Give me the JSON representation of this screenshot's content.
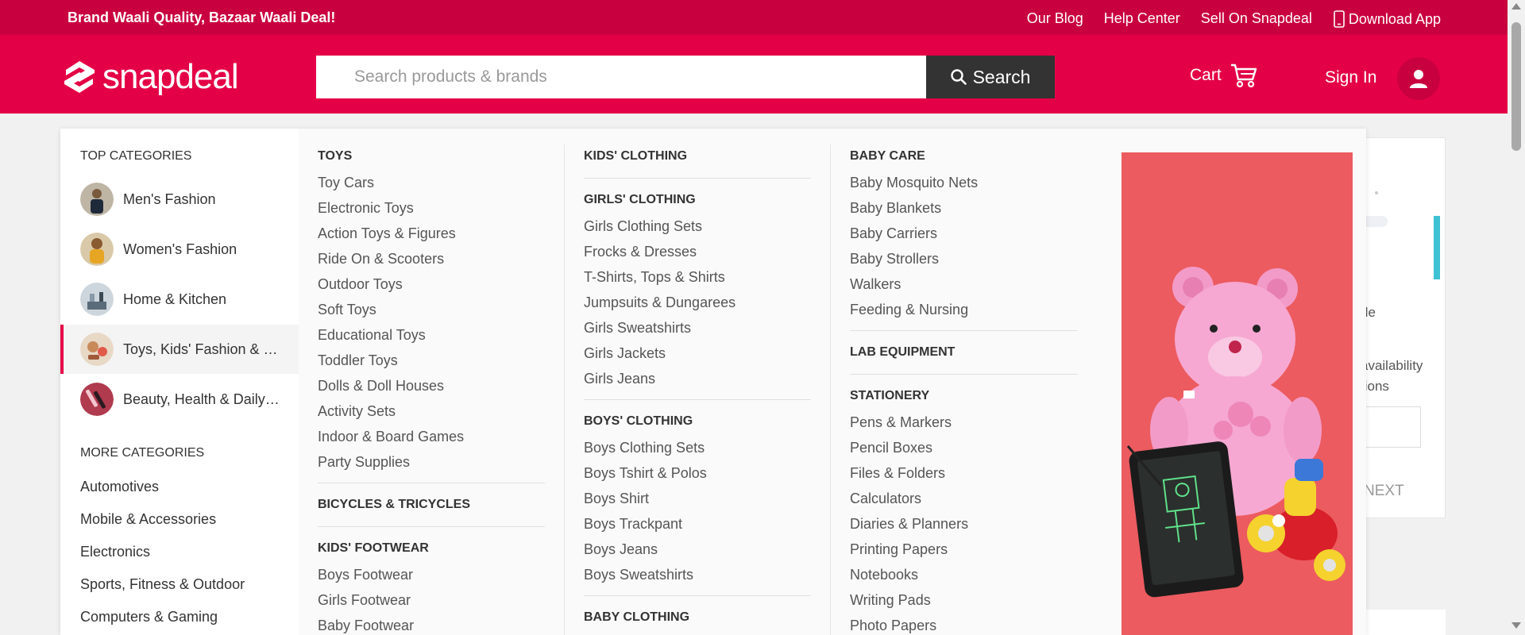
{
  "topbar": {
    "tagline": "Brand Waali Quality, Bazaar Waali Deal!",
    "links": {
      "blog": "Our Blog",
      "help": "Help Center",
      "sell": "Sell On Snapdeal",
      "download": "Download App"
    }
  },
  "header": {
    "logo_text": "snapdeal",
    "search": {
      "placeholder": "Search products & brands",
      "button_label": "Search"
    },
    "cart_label": "Cart",
    "signin_label": "Sign In"
  },
  "colors": {
    "topbar": "#c9003f",
    "header": "#e40046",
    "search_button": "#333333",
    "promo_bg": "#ec5b5f"
  },
  "leftnav": {
    "top_heading": "TOP CATEGORIES",
    "top_categories": [
      {
        "label": "Men's Fashion"
      },
      {
        "label": "Women's Fashion"
      },
      {
        "label": "Home & Kitchen"
      },
      {
        "label": "Toys, Kids' Fashion & more"
      },
      {
        "label": "Beauty, Health & Daily Needs"
      }
    ],
    "more_heading": "MORE CATEGORIES",
    "more_categories": [
      "Automotives",
      "Mobile & Accessories",
      "Electronics",
      "Sports, Fitness & Outdoor",
      "Computers & Gaming"
    ]
  },
  "menu": {
    "col1": {
      "toys_heading": "TOYS",
      "toys": [
        "Toy Cars",
        "Electronic Toys",
        "Action Toys & Figures",
        "Ride On & Scooters",
        "Outdoor Toys",
        "Soft Toys",
        "Educational Toys",
        "Toddler Toys",
        "Dolls & Doll Houses",
        "Activity Sets",
        "Indoor & Board Games",
        "Party Supplies"
      ],
      "bicycles_heading": "BICYCLES & TRICYCLES",
      "footwear_heading": "KIDS' FOOTWEAR",
      "footwear": [
        "Boys Footwear",
        "Girls Footwear",
        "Baby Footwear"
      ]
    },
    "col2": {
      "kids_heading": "KIDS' CLOTHING",
      "girls_heading": "GIRLS' CLOTHING",
      "girls": [
        "Girls Clothing Sets",
        "Frocks & Dresses",
        "T-Shirts, Tops & Shirts",
        "Jumpsuits & Dungarees",
        "Girls Sweatshirts",
        "Girls Jackets",
        "Girls Jeans"
      ],
      "boys_heading": "BOYS' CLOTHING",
      "boys": [
        "Boys Clothing Sets",
        "Boys Tshirt & Polos",
        "Boys Shirt",
        "Boys Trackpant",
        "Boys Jeans",
        "Boys Sweatshirts"
      ],
      "baby_heading": "BABY CLOTHING"
    },
    "col3": {
      "babycare_heading": "BABY CARE",
      "babycare": [
        "Baby Mosquito Nets",
        "Baby Blankets",
        "Baby Carriers",
        "Baby Strollers",
        "Walkers",
        "Feeding & Nursing"
      ],
      "lab_heading": "LAB EQUIPMENT",
      "stationery_heading": "STATIONERY",
      "stationery": [
        "Pens & Markers",
        "Pencil Boxes",
        "Files & Folders",
        "Calculators",
        "Diaries & Planners",
        "Printing Papers",
        "Notebooks",
        "Writing Pads",
        "Photo Papers"
      ]
    }
  },
  "background_card": {
    "frag1": "de",
    "frag2_line1": "availability",
    "frag2_line2": "tions",
    "next_label": "NEXT"
  }
}
